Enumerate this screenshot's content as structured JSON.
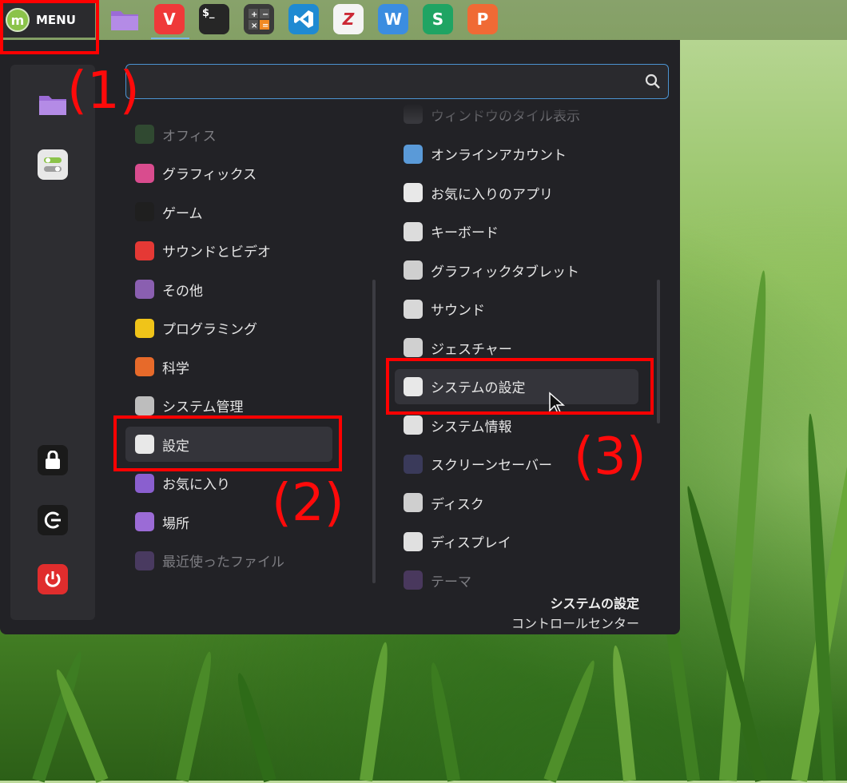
{
  "panel": {
    "menu_label": "MENU",
    "taskbar_apps": [
      {
        "name": "files",
        "glyph": "",
        "color": "#9b6bd6"
      },
      {
        "name": "vivaldi",
        "glyph": "V",
        "color": "#ef3939"
      },
      {
        "name": "terminal",
        "glyph": "$_",
        "color": "#2a2a2a"
      },
      {
        "name": "calculator",
        "glyph": "±",
        "color": "#3a3a3a"
      },
      {
        "name": "vscode",
        "glyph": "⟩",
        "color": "#1f8ad2"
      },
      {
        "name": "zotero",
        "glyph": "Z",
        "color": "#f2f2f2"
      },
      {
        "name": "writer",
        "glyph": "W",
        "color": "#3b8de0"
      },
      {
        "name": "spreadsheets",
        "glyph": "S",
        "color": "#1fa463"
      },
      {
        "name": "presentation",
        "glyph": "P",
        "color": "#f06a35"
      }
    ]
  },
  "categories": [
    {
      "label": "オフィス",
      "icon": "office-icon",
      "color": "#3c6a3a",
      "dim": true
    },
    {
      "label": "グラフィックス",
      "icon": "graphics-icon",
      "color": "#d94c8e"
    },
    {
      "label": "ゲーム",
      "icon": "game-icon",
      "color": "#1f1f1f"
    },
    {
      "label": "サウンドとビデオ",
      "icon": "sound-video-icon",
      "color": "#e53935"
    },
    {
      "label": "その他",
      "icon": "other-icon",
      "color": "#8a5fb0"
    },
    {
      "label": "プログラミング",
      "icon": "programming-icon",
      "color": "#f0c419"
    },
    {
      "label": "科学",
      "icon": "science-icon",
      "color": "#e76a2a"
    },
    {
      "label": "システム管理",
      "icon": "system-admin-icon",
      "color": "#bdbdbd"
    },
    {
      "label": "設定",
      "icon": "settings-icon",
      "color": "#e8e8e8",
      "selected": true
    },
    {
      "label": "お気に入り",
      "icon": "favorites-icon",
      "color": "#8a5fcf"
    },
    {
      "label": "場所",
      "icon": "places-icon",
      "color": "#9b6bd6"
    },
    {
      "label": "最近使ったファイル",
      "icon": "recent-files-icon",
      "color": "#6a4f8f",
      "dim": true
    }
  ],
  "apps": [
    {
      "label": "ウィンドウのタイル表示",
      "icon": "window-tile-icon",
      "color": "#4a4a50",
      "dim": true
    },
    {
      "label": "オンラインアカウント",
      "icon": "online-accounts-icon",
      "color": "#5a9ad8"
    },
    {
      "label": "お気に入りのアプリ",
      "icon": "preferred-apps-icon",
      "color": "#e8e8e8"
    },
    {
      "label": "キーボード",
      "icon": "keyboard-icon",
      "color": "#dcdcdc"
    },
    {
      "label": "グラフィックタブレット",
      "icon": "tablet-icon",
      "color": "#cfcfcf"
    },
    {
      "label": "サウンド",
      "icon": "sound-icon",
      "color": "#d8d8d8"
    },
    {
      "label": "ジェスチャー",
      "icon": "gesture-icon",
      "color": "#d0d0d0"
    },
    {
      "label": "システムの設定",
      "icon": "system-settings-icon",
      "color": "#e8e8e8",
      "selected": true
    },
    {
      "label": "システム情報",
      "icon": "system-info-icon",
      "color": "#e0e0e0"
    },
    {
      "label": "スクリーンセーバー",
      "icon": "screensaver-icon",
      "color": "#3a3a5a"
    },
    {
      "label": "ディスク",
      "icon": "disks-icon",
      "color": "#cfcfcf"
    },
    {
      "label": "ディスプレイ",
      "icon": "display-icon",
      "color": "#e0e0e0"
    },
    {
      "label": "テーマ",
      "icon": "themes-icon",
      "color": "#6a4a8a",
      "dim": true
    }
  ],
  "description": {
    "title": "システムの設定",
    "subtitle": "コントロールセンター"
  },
  "annotations": {
    "one": "(1)",
    "two": "(2)",
    "three": "(3)"
  },
  "colors": {
    "highlight_box": "#ff0000",
    "menu_bg": "#222226",
    "search_border": "#4b93d1"
  }
}
